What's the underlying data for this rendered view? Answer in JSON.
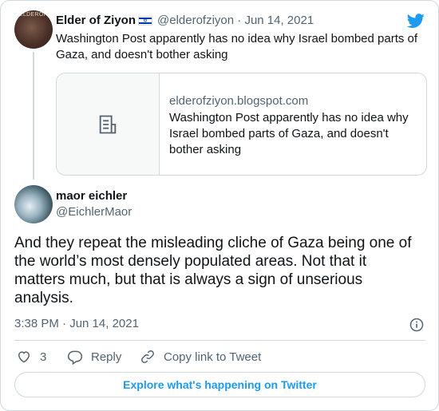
{
  "quoted": {
    "author_name": "Elder of Ziyon",
    "avatar_text": "ELDEROF",
    "handle_date": "@elderofziyon · Jun 14, 2021",
    "text": "Washington Post apparently has no idea why Israel bombed parts of Gaza, and doesn't bother asking",
    "link_card": {
      "domain": "elderofziyon.blogspot.com",
      "title": "Washington Post apparently has no idea why Israel bombed parts of Gaza, and doesn't bother asking"
    }
  },
  "tweet": {
    "author_name": "maor eichler",
    "handle": "@EichlerMaor",
    "text": "And they repeat the misleading cliche of Gaza being one of the world’s most densely populated areas. Not that it matters much, but that is always a sign of unserious analysis.",
    "timestamp": "3:38 PM · Jun 14, 2021"
  },
  "actions": {
    "like_count": "3",
    "reply_label": "Reply",
    "copy_link_label": "Copy link to Tweet"
  },
  "explore_label": "Explore what's happening on Twitter",
  "icons": {
    "twitter": "twitter-bird-icon",
    "flag": "israel-flag-icon",
    "document": "document-icon",
    "info": "info-icon",
    "heart": "heart-icon",
    "reply": "reply-bubble-icon",
    "link": "link-icon"
  },
  "colors": {
    "accent": "#1d9bf0",
    "text": "#0f1419",
    "muted": "#536471",
    "border": "#cfd9de"
  }
}
